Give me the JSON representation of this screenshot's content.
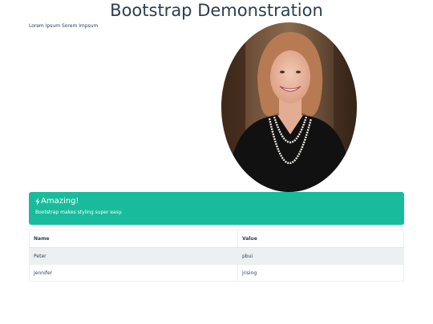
{
  "page": {
    "title": "Bootstrap Demonstration",
    "lorem": "Lorem Ipsum Sorem Impsum"
  },
  "alert": {
    "icon": "bolt-icon",
    "heading": "Amazing!",
    "text": "Bootstrap makes styling super easy.",
    "color": "#18bc9c"
  },
  "table": {
    "headers": [
      "Name",
      "Value"
    ],
    "rows": [
      [
        "Peter",
        "pbui"
      ],
      [
        "Jennifer",
        "jrising"
      ]
    ]
  }
}
